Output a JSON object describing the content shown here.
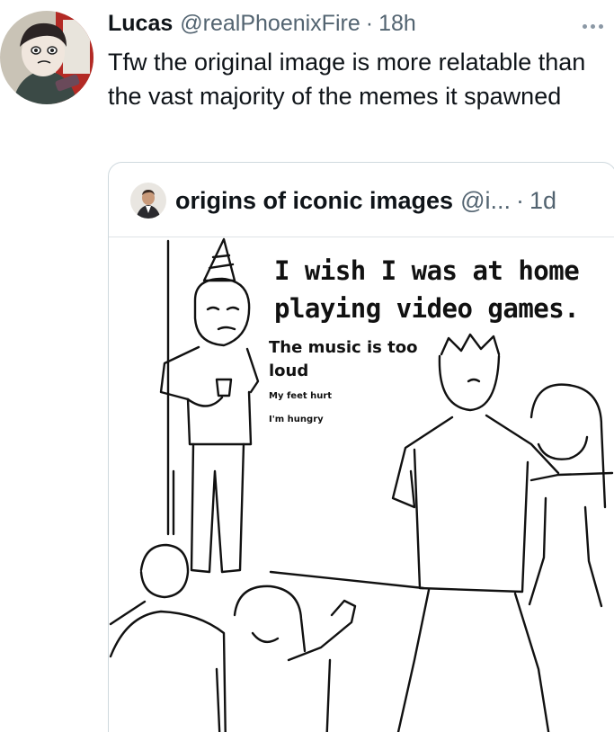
{
  "tweet": {
    "author_name": "Lucas",
    "author_handle": "@realPhoenixFire",
    "separator": "·",
    "time": "18h",
    "text": "Tfw the original image is more relatable than the vast majority of the memes it spawned",
    "more_icon": "more-horizontal-icon"
  },
  "quoted_tweet": {
    "author_name": "origins of iconic images",
    "author_handle": "@i...",
    "separator": "·",
    "time": "1d",
    "image": {
      "caption_main_1": "I wish I was at home",
      "caption_main_2": "playing video games.",
      "caption_secondary_1": "The music is too",
      "caption_secondary_2": "loud",
      "caption_small_1": "My feet hurt",
      "caption_small_2": "I'm hungry"
    }
  },
  "colors": {
    "text_primary": "#0f1419",
    "text_secondary": "#536471",
    "border": "#cfd9de"
  }
}
